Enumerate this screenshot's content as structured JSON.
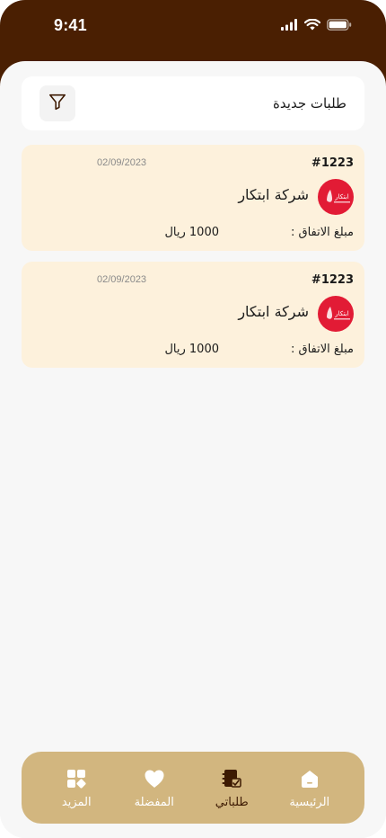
{
  "status_bar": {
    "time": "9:41"
  },
  "header": {
    "title": "طلبات جديدة",
    "filter_icon": "filter-icon"
  },
  "orders": [
    {
      "id": "#1223",
      "date": "02/09/2023",
      "company": "شركة ابتكار",
      "amount_label": "مبلغ الاتفاق :",
      "amount": "1000 ريال",
      "logo_text": "ابتكار"
    },
    {
      "id": "#1223",
      "date": "02/09/2023",
      "company": "شركة ابتكار",
      "amount_label": "مبلغ الاتفاق :",
      "amount": "1000 ريال",
      "logo_text": "ابتكار"
    }
  ],
  "bottom_nav": {
    "items": [
      {
        "label": "المزيد",
        "icon": "grid-icon"
      },
      {
        "label": "المفضلة",
        "icon": "heart-icon"
      },
      {
        "label": "طلباتي",
        "icon": "orders-icon",
        "active": true
      },
      {
        "label": "الرئيسية",
        "icon": "home-icon"
      }
    ]
  },
  "colors": {
    "header_bg": "#4a1f02",
    "card_bg": "#fdf1dc",
    "nav_bg": "#d2b67f",
    "logo_red": "#e21b35",
    "active_label": "#3d1a02"
  }
}
